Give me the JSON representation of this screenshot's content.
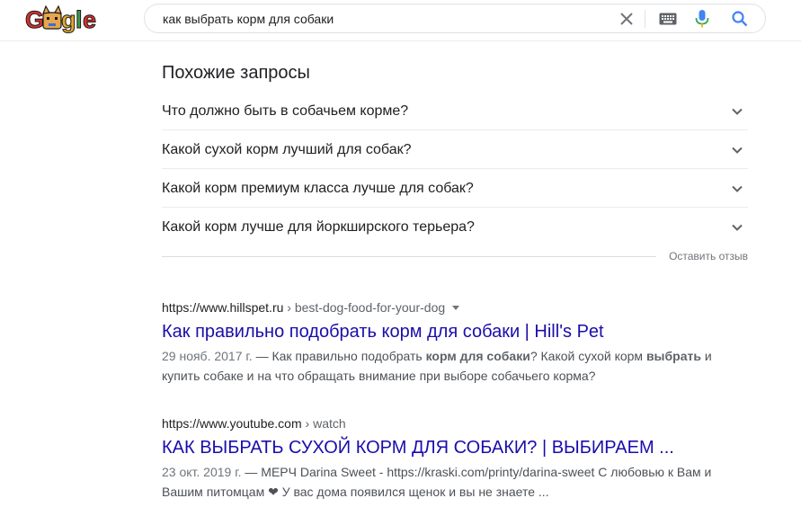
{
  "header": {
    "logo_text": "Google",
    "search_query": "как выбрать корм для собаки",
    "icons": [
      "clear-icon",
      "keyboard-icon",
      "mic-icon",
      "search-icon"
    ]
  },
  "related": {
    "title": "Похожие запросы",
    "questions": [
      "Что должно быть в собачьем корме?",
      "Какой сухой корм лучший для собак?",
      "Какой корм премиум класса лучше для собак?",
      "Какой корм лучше для йоркширского терьера?"
    ],
    "feedback": "Оставить отзыв"
  },
  "results": [
    {
      "domain": "https://www.hillspet.ru",
      "path": " › best-dog-food-for-your-dog",
      "title": "Как правильно подобрать корм для собаки | Hill's Pet",
      "date": "29 нояб. 2017 г.",
      "s1": " — Как правильно подобрать ",
      "b1": "корм для собаки",
      "s2": "? Какой сухой корм ",
      "b2": "выбрать",
      "s3": " и купить собаке и на что обращать внимание при выборе собачьего корма?"
    },
    {
      "domain": "https://www.youtube.com",
      "path": " › watch",
      "title": "КАК ВЫБРАТЬ СУХОЙ КОРМ ДЛЯ СОБАКИ? | ВЫБИРАЕМ ...",
      "date": "23 окт. 2019 г.",
      "s1": " — МЕРЧ Darina Sweet - https://kraski.com/printy/darina-sweet С любовью к Вам и Вашим питомцам ❤ У вас дома появился щенок и вы не знаете ..."
    }
  ],
  "colors": {
    "link": "#1a0dab",
    "text": "#202124",
    "snippet": "#4d5156",
    "muted": "#70757a"
  }
}
